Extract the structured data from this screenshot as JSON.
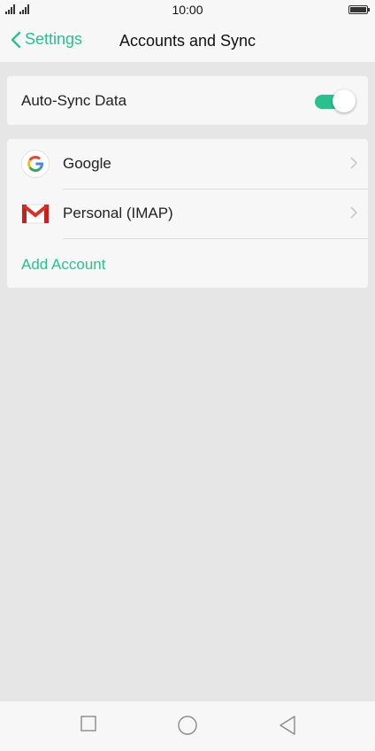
{
  "status_bar": {
    "time": "10:00"
  },
  "header": {
    "back_label": "Settings",
    "title": "Accounts and Sync"
  },
  "sync": {
    "label": "Auto-Sync Data",
    "enabled": true,
    "accent_color": "#27c28e"
  },
  "accounts": {
    "items": [
      {
        "name": "Google",
        "icon": "google-icon"
      },
      {
        "name": "Personal (IMAP)",
        "icon": "gmail-icon"
      }
    ],
    "add_label": "Add Account"
  },
  "nav_bar": {
    "buttons": [
      "recent-apps-icon",
      "home-icon",
      "back-triangle-icon"
    ]
  }
}
